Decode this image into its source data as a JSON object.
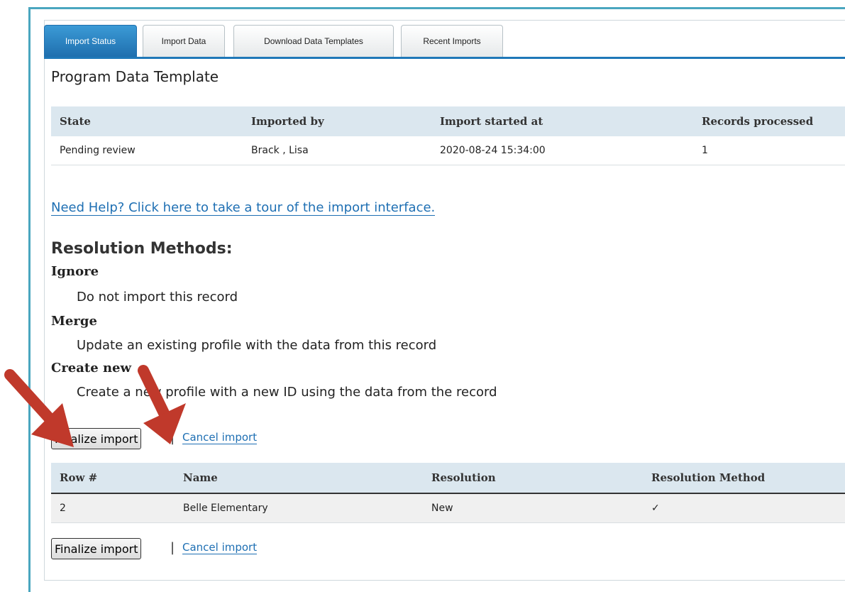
{
  "tabs": [
    {
      "label": "Import Status",
      "active": true
    },
    {
      "label": "Import Data",
      "active": false
    },
    {
      "label": "Download Data Templates",
      "active": false
    },
    {
      "label": "Recent Imports",
      "active": false
    }
  ],
  "page_title": "Program Data Template",
  "status_table": {
    "headers": [
      "State",
      "Imported by",
      "Import started at",
      "Records processed"
    ],
    "row": [
      "Pending review",
      "Brack , Lisa",
      "2020-08-24 15:34:00",
      "1"
    ]
  },
  "help_link": "Need Help? Click here to take a tour of the import interface.",
  "resolution": {
    "heading": "Resolution Methods:",
    "methods": [
      {
        "term": "Ignore",
        "desc": "Do not import this record"
      },
      {
        "term": "Merge",
        "desc": "Update an existing profile with the data from this record"
      },
      {
        "term": "Create new",
        "desc": "Create a new profile with a new ID using the data from the record"
      }
    ]
  },
  "actions": {
    "finalize_label": "Finalize import",
    "separator": "|",
    "cancel_label": "Cancel import"
  },
  "rows_table": {
    "headers": [
      "Row #",
      "Name",
      "Resolution",
      "Resolution Method"
    ],
    "rows": [
      [
        "2",
        "Belle Elementary",
        "New",
        "✓"
      ]
    ]
  },
  "colors": {
    "frame": "#4aa6bf",
    "active_tab": "#1f78b8",
    "link": "#1e6fb3",
    "arrow": "#c0392b"
  }
}
